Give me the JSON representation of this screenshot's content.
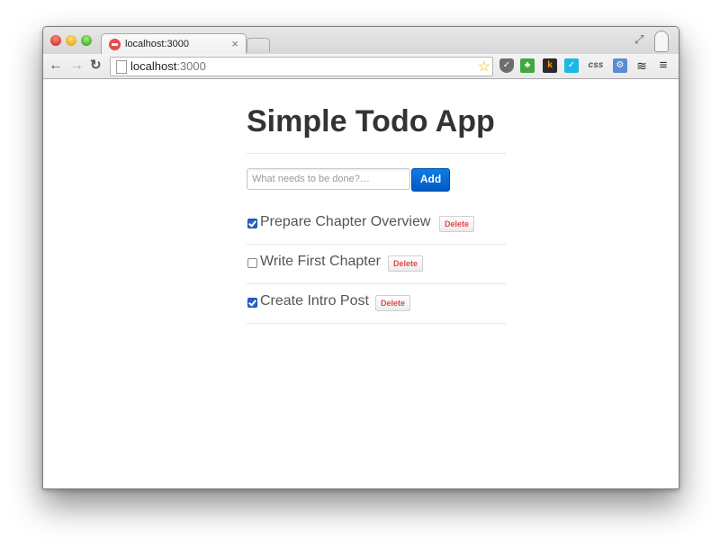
{
  "browser": {
    "tab_title": "localhost:3000",
    "tab_close": "×",
    "url_host": "localhost",
    "url_port": ":3000",
    "icons": [
      "close-icon",
      "back-arrow-icon",
      "forward-arrow-icon",
      "reload-icon",
      "page-icon",
      "star-icon",
      "pocket-icon",
      "evernote-icon",
      "klout-icon",
      "checkmark-icon",
      "css-icon",
      "puzzle-icon",
      "layers-icon",
      "menu-icon",
      "fullscreen-icon",
      "profile-icon"
    ],
    "ext_labels": {
      "klout": "k",
      "css": "css",
      "check": "✓"
    }
  },
  "app": {
    "title": "Simple Todo App",
    "input_placeholder": "What needs to be done?…",
    "add_label": "Add",
    "delete_label": "Delete",
    "todos": [
      {
        "text": "Prepare Chapter Overview",
        "done": true
      },
      {
        "text": "Write First Chapter",
        "done": false
      },
      {
        "text": "Create Intro Post",
        "done": true
      }
    ]
  },
  "colors": {
    "primary_button": "#0066d6",
    "delete_text": "#e2474b",
    "title_text": "#333333",
    "todo_text": "#555555"
  }
}
